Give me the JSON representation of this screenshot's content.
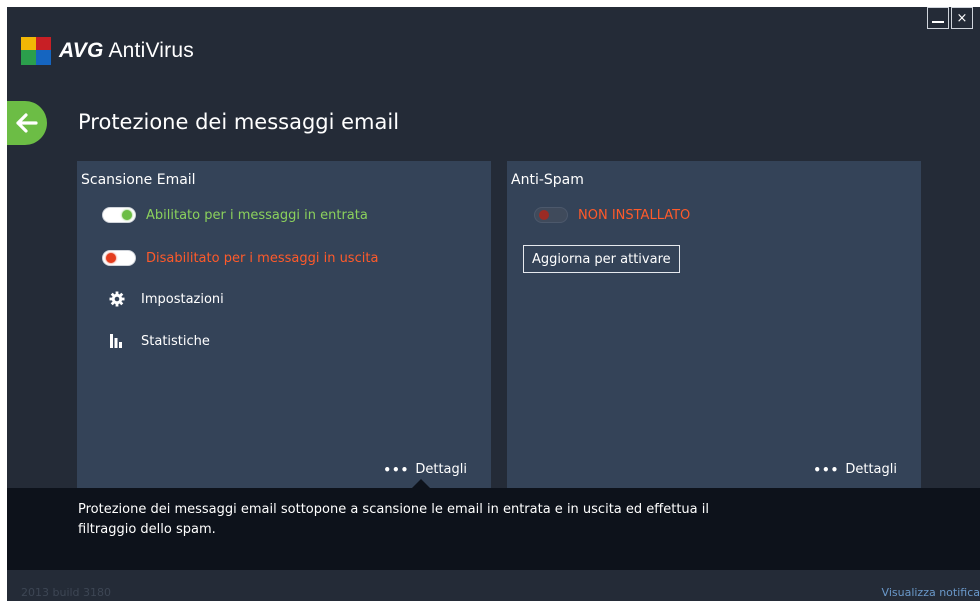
{
  "app": {
    "brand_bold": "AVG",
    "brand_name": "AntiVirus",
    "window_buttons": {
      "minimize": "minimize",
      "close": "×"
    }
  },
  "header": {
    "title": "Protezione dei messaggi email",
    "back_icon": "arrow-left-icon"
  },
  "scansione": {
    "title": "Scansione Email",
    "incoming_label": "Abilitato per i messaggi in entrata",
    "incoming_state": "on",
    "outgoing_label": "Disabilitato per i messaggi in uscita",
    "outgoing_state": "off",
    "settings_label": "Impostazioni",
    "stats_label": "Statistiche",
    "details_label": "Dettagli"
  },
  "antispam": {
    "title": "Anti-Spam",
    "status_label": "NON INSTALLATO",
    "upgrade_label": "Aggiorna per attivare",
    "details_label": "Dettagli"
  },
  "description": "Protezione dei messaggi email sottopone a scansione le email in entrata e in uscita ed effettua il filtraggio dello spam.",
  "footer": {
    "build": "2013  build 3180",
    "notify": "Visualizza notifica"
  },
  "colors": {
    "background": "#242b37",
    "panel": "#344358",
    "green": "#6cbd45",
    "red": "#e43d1e",
    "band": "#0d121b"
  }
}
